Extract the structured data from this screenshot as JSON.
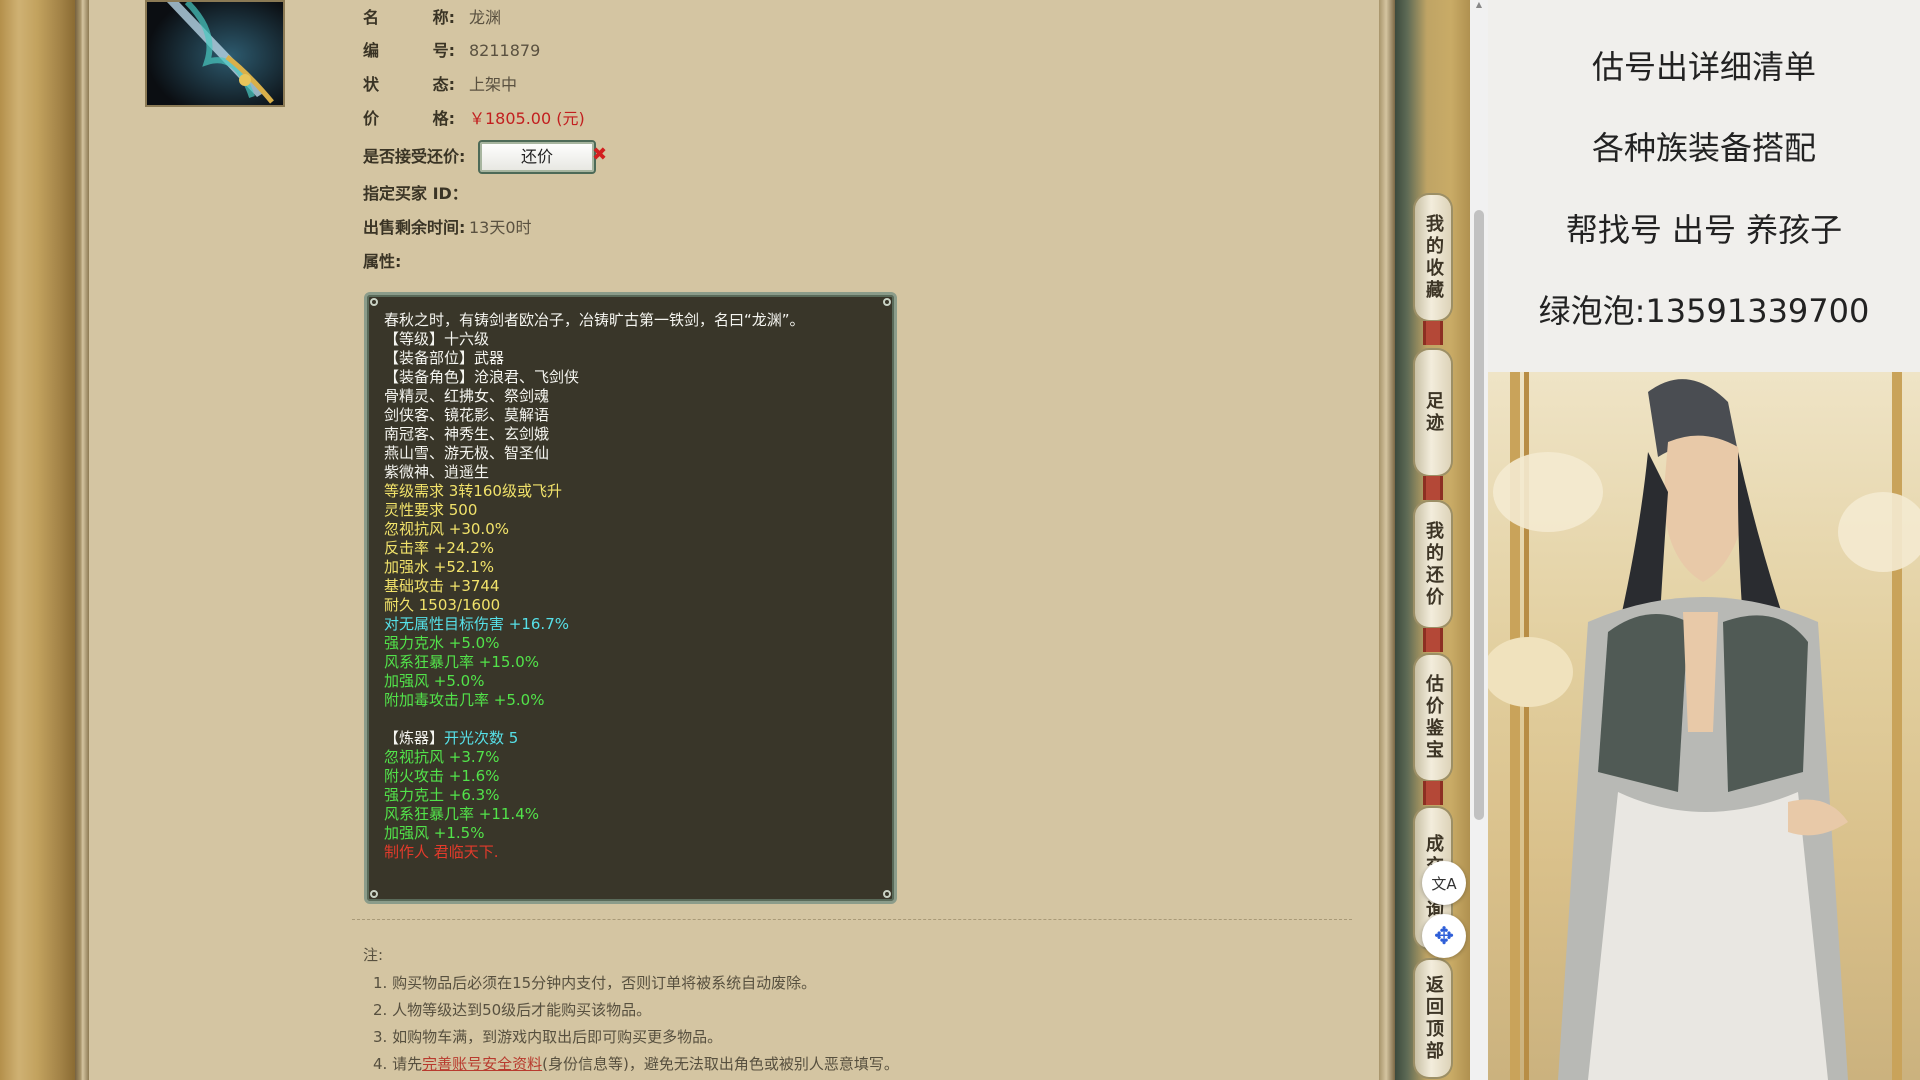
{
  "item": {
    "name_label_a": "名",
    "name_label_b": "称:",
    "name": "龙渊",
    "id_label_a": "编",
    "id_label_b": "号:",
    "id": "8211879",
    "status_label_a": "状",
    "status_label_b": "态:",
    "status": "上架中",
    "price_label_a": "价",
    "price_label_b": "格:",
    "price": "￥1805.00 (元)",
    "counter_label": "是否接受还价:",
    "counter_button": "还价",
    "counter_x": "✖",
    "buyer_label": "指定买家 ID：",
    "time_label": "出售剩余时间:",
    "time_left": "13天0时",
    "attr_label": "属性:"
  },
  "attributes": [
    {
      "text": "春秋之时，有铸剑者欧冶子，冶铸旷古第一铁剑，名曰“龙渊”。",
      "color": "white"
    },
    {
      "text": "【等级】十六级",
      "color": "white"
    },
    {
      "text": "【装备部位】武器",
      "color": "white"
    },
    {
      "text": "【装备角色】沧浪君、飞剑侠",
      "color": "white"
    },
    {
      "text": "骨精灵、红拂女、祭剑魂",
      "color": "white"
    },
    {
      "text": "剑侠客、镜花影、莫解语",
      "color": "white"
    },
    {
      "text": "南冠客、神秀生、玄剑娥",
      "color": "white"
    },
    {
      "text": "燕山雪、游无极、智圣仙",
      "color": "white"
    },
    {
      "text": "紫微神、逍遥生",
      "color": "white"
    },
    {
      "text": "等级需求 3转160级或飞升",
      "color": "yellow"
    },
    {
      "text": "灵性要求 500",
      "color": "yellow"
    },
    {
      "text": "忽视抗风 +30.0%",
      "color": "yellow"
    },
    {
      "text": "反击率 +24.2%",
      "color": "yellow"
    },
    {
      "text": "加强水 +52.1%",
      "color": "yellow"
    },
    {
      "text": "基础攻击 +3744",
      "color": "yellow"
    },
    {
      "text": "耐久 1503/1600",
      "color": "yellow"
    },
    {
      "text": "对无属性目标伤害 +16.7%",
      "color": "cyan"
    },
    {
      "text": "强力克水 +5.0%",
      "color": "green"
    },
    {
      "text": "风系狂暴几率 +15.0%",
      "color": "green"
    },
    {
      "text": "加强风 +5.0%",
      "color": "green"
    },
    {
      "text": "附加毒攻击几率 +5.0%",
      "color": "green"
    }
  ],
  "refine": {
    "prefix": "【炼器】",
    "count_text": "开光次数 5",
    "lines": [
      "忽视抗风 +3.7%",
      "附火攻击 +1.6%",
      "强力克土 +6.3%",
      "风系狂暴几率 +11.4%",
      "加强风 +1.5%"
    ]
  },
  "maker": "制作人 君临天下.",
  "notes": {
    "title": "注:",
    "n1": "1. 购买物品后必须在15分钟内支付，否则订单将被系统自动废除。",
    "n2": "2. 人物等级达到50级后才能购买该物品。",
    "n3": "3. 如购物车满，到游戏内取出后即可购买更多物品。",
    "n4_pre": "4. 请先",
    "n4_link": "完善账号安全资料",
    "n4_post": "(身份信息等)，避免无法取出角色或被别人恶意填写。"
  },
  "side_tabs": [
    "我的收藏",
    "足迹",
    "我的还价",
    "估价鉴宝",
    "成交查询",
    "返回顶部"
  ],
  "float_buttons": {
    "translate_icon": "文A",
    "ai_icon": "✥"
  },
  "ad": {
    "line1": "估号出详细清单",
    "line2": "各种族装备搭配",
    "line3": "帮找号 出号 养孩子",
    "line4": "绿泡泡:13591339700"
  },
  "colors": {
    "price": "#c21f1f",
    "attr_bg": "#393629",
    "yellow": "#f1e26a",
    "green": "#52e34a",
    "cyan": "#56e0e8",
    "red": "#e23b2b"
  }
}
